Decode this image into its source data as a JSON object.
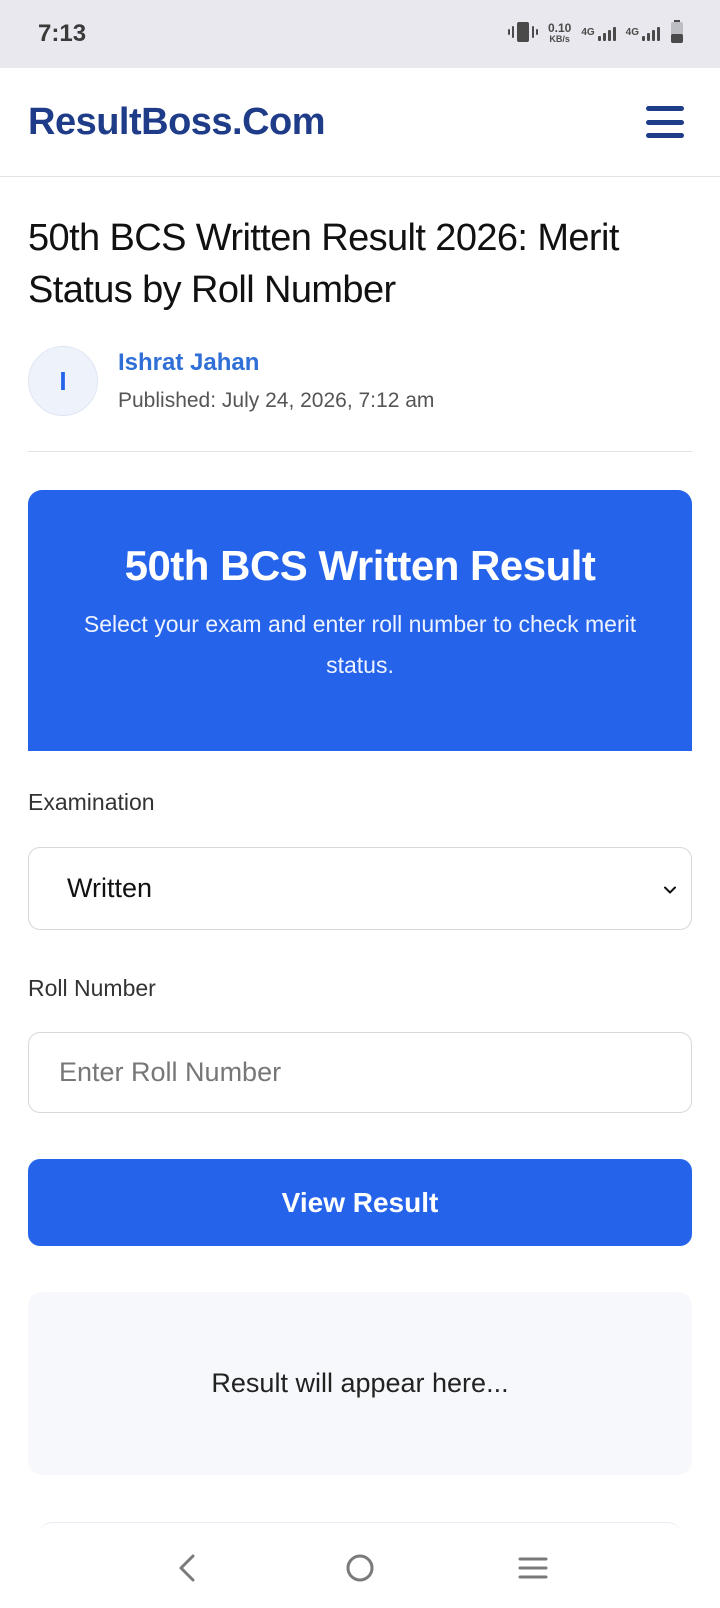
{
  "status_bar": {
    "time": "7:13",
    "speed_value": "0.10",
    "speed_unit": "KB/s",
    "network_1": "4G",
    "network_2": "4G"
  },
  "header": {
    "brand": "ResultBoss.Com"
  },
  "article": {
    "title": "50th BCS Written Result 2026: Merit Status by Roll Number",
    "author_initial": "I",
    "author_name": "Ishrat Jahan",
    "published": "Published: July 24, 2026, 7:12 am"
  },
  "hero": {
    "title": "50th BCS Written Result",
    "subtitle": "Select your exam and enter roll number to check merit status."
  },
  "form": {
    "exam_label": "Examination",
    "exam_selected": "Written",
    "roll_label": "Roll Number",
    "roll_placeholder": "Enter Roll Number",
    "roll_value": "",
    "submit_label": "View Result"
  },
  "result": {
    "placeholder": "Result will appear here..."
  },
  "colors": {
    "brand": "#1f3c88",
    "accent": "#2563eb",
    "author": "#2f6fd6"
  },
  "icons": {
    "vibrate": "vibrate-icon",
    "battery": "battery-icon",
    "menu": "hamburger-menu-icon",
    "back": "back-icon",
    "home": "home-icon",
    "recents": "recents-icon"
  }
}
